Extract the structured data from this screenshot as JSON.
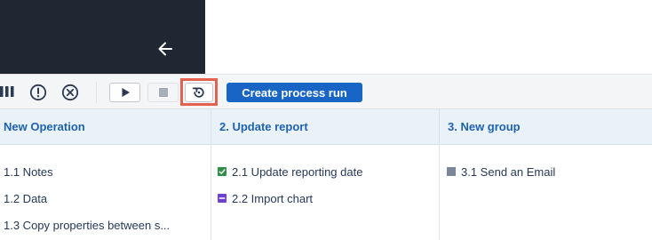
{
  "toolbar": {
    "create_label": "Create process run"
  },
  "columns": [
    {
      "title": "New Operation",
      "items": [
        {
          "label": "1.1 Notes",
          "marker": "none"
        },
        {
          "label": "1.2 Data",
          "marker": "none"
        },
        {
          "label": "1.3 Copy properties between s...",
          "marker": "none"
        }
      ]
    },
    {
      "title": "2. Update report",
      "items": [
        {
          "label": "2.1 Update reporting date",
          "marker": "check-green"
        },
        {
          "label": "2.2 Import chart",
          "marker": "minus-purple"
        }
      ]
    },
    {
      "title": "3. New group",
      "items": [
        {
          "label": "3.1 Send an Email",
          "marker": "square-gray"
        }
      ]
    }
  ],
  "icons": [
    "arrow-left-icon",
    "kanban-icon",
    "alert-circle-icon",
    "cancel-circle-icon",
    "play-icon",
    "stop-icon",
    "restart-icon"
  ],
  "colors": {
    "dark_panel": "#1f2733",
    "primary": "#1965c6",
    "column_header_bg": "#e9f1f9",
    "column_header_text": "#1e62b0",
    "highlight": "#e5604e",
    "marker_green": "#2f8f48",
    "marker_purple": "#6e3fd1",
    "marker_gray": "#7a869a"
  }
}
